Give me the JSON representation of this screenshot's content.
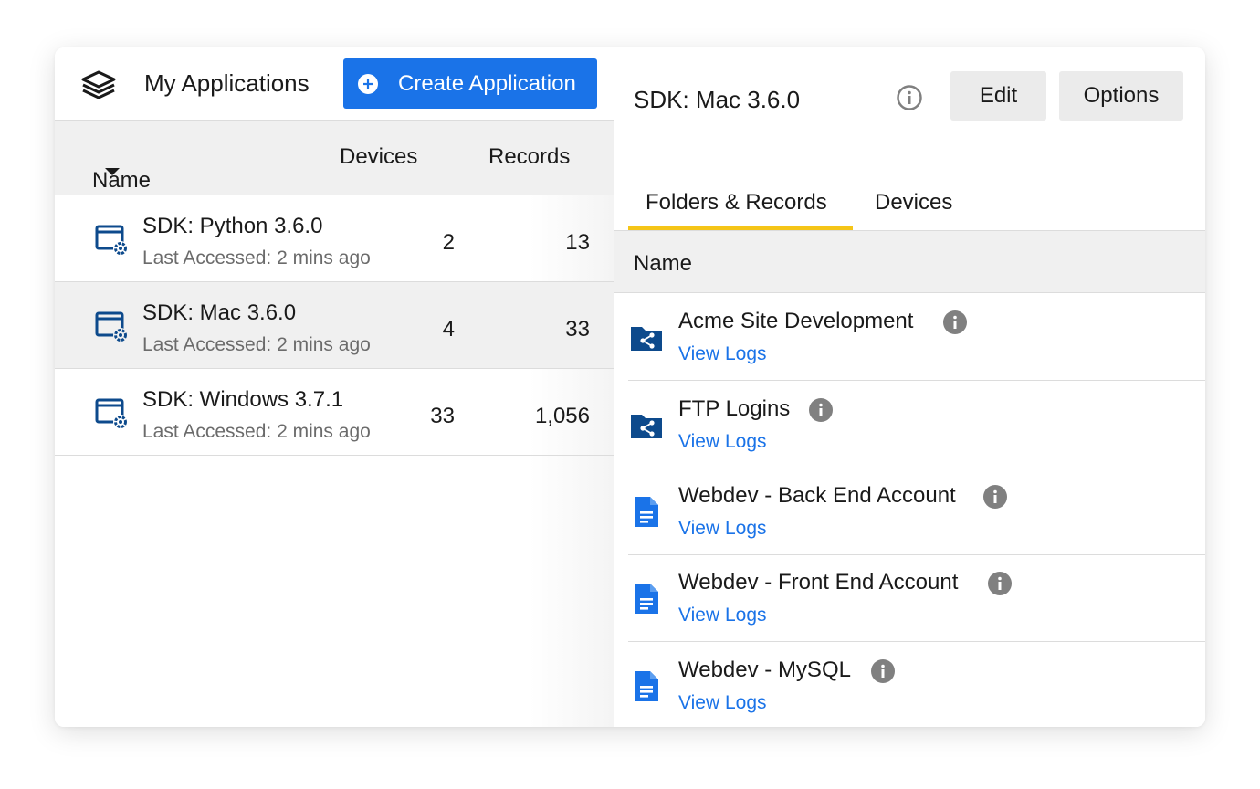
{
  "left": {
    "title": "My Applications",
    "create_label": "Create Application",
    "columns": {
      "name": "Name",
      "devices": "Devices",
      "records": "Records"
    },
    "apps": [
      {
        "name": "SDK: Python 3.6.0",
        "sub": "Last Accessed: 2 mins ago",
        "devices": "2",
        "records": "13"
      },
      {
        "name": "SDK: Mac 3.6.0",
        "sub": "Last Accessed: 2 mins ago",
        "devices": "4",
        "records": "33"
      },
      {
        "name": "SDK: Windows 3.7.1",
        "sub": "Last Accessed: 2 mins ago",
        "devices": "33",
        "records": "1,056"
      }
    ]
  },
  "right": {
    "title": "SDK: Mac 3.6.0",
    "edit_label": "Edit",
    "options_label": "Options",
    "tabs": [
      {
        "label": "Folders & Records"
      },
      {
        "label": "Devices"
      }
    ],
    "list_header": "Name",
    "records": [
      {
        "name": "Acme Site Development",
        "link": "View Logs",
        "icon": "shared-folder-icon"
      },
      {
        "name": "FTP Logins",
        "link": "View Logs",
        "icon": "shared-folder-icon"
      },
      {
        "name": "Webdev - Back End Account",
        "link": "View Logs",
        "icon": "document-icon"
      },
      {
        "name": "Webdev - Front End Account",
        "link": "View Logs",
        "icon": "document-icon"
      },
      {
        "name": "Webdev - MySQL",
        "link": "View Logs",
        "icon": "document-icon"
      }
    ]
  },
  "colors": {
    "accent": "#1a73e8",
    "tab_underline": "#f5c518",
    "icon_dark": "#0d4a8c",
    "info_gray": "#808080"
  }
}
